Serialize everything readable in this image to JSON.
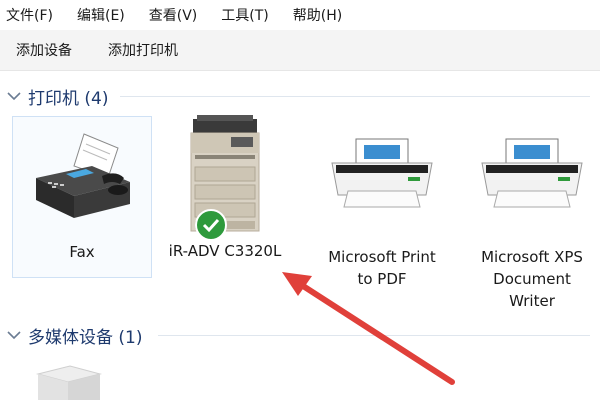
{
  "menubar": {
    "items": [
      "文件(F)",
      "编辑(E)",
      "查看(V)",
      "工具(T)",
      "帮助(H)"
    ]
  },
  "toolbar": {
    "add_device": "添加设备",
    "add_printer": "添加打印机"
  },
  "groups": {
    "printers": {
      "title": "打印机 (4)"
    },
    "multimedia": {
      "title": "多媒体设备 (1)"
    }
  },
  "devices": [
    {
      "label": "Fax",
      "icon": "fax-icon",
      "selected": true
    },
    {
      "label": "iR-ADV C3320L",
      "icon": "copier-printer-icon",
      "default": true
    },
    {
      "label": "Microsoft Print\nto PDF",
      "icon": "printer-icon"
    },
    {
      "label": "Microsoft XPS\nDocument\nWriter",
      "icon": "printer-icon"
    }
  ],
  "colors": {
    "accent_arrow": "#e0403a",
    "default_check": "#2e9a3c",
    "selection_border": "#cfe1f5",
    "header_text": "#1e3a6e"
  }
}
